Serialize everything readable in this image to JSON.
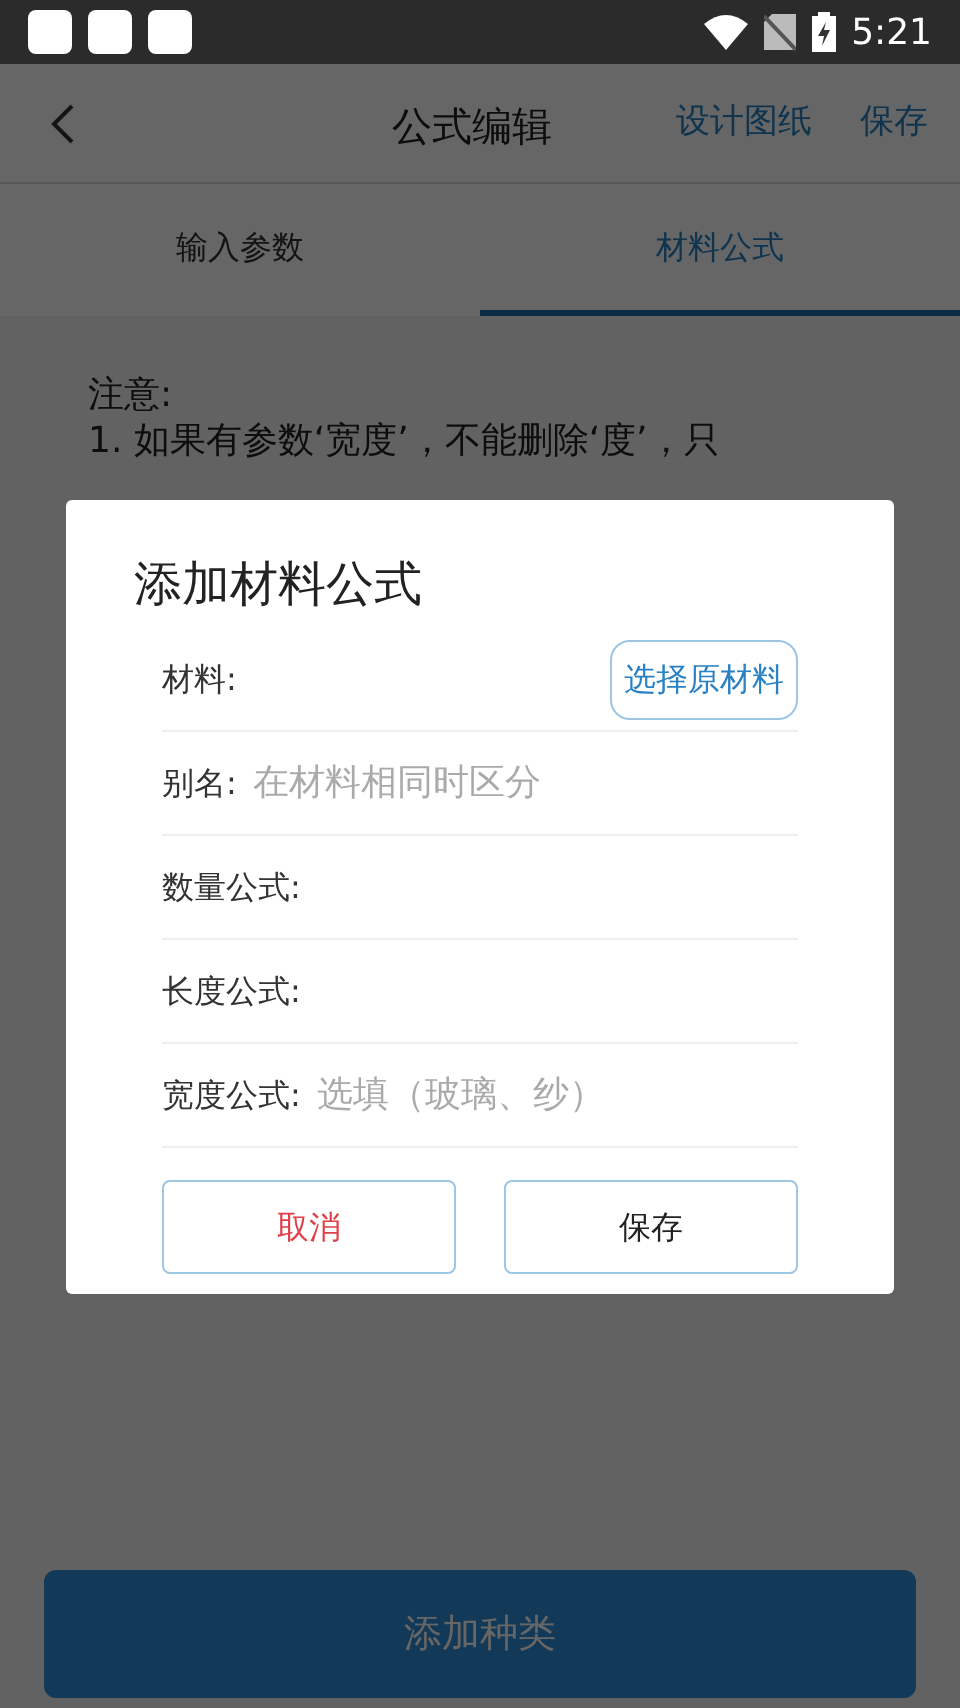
{
  "status_bar": {
    "time": "5:21"
  },
  "app_bar": {
    "title": "公式编辑",
    "actions": [
      "设计图纸",
      "保存"
    ]
  },
  "tabs": [
    {
      "label": "输入参数",
      "selected": false
    },
    {
      "label": "材料公式",
      "selected": true
    }
  ],
  "note": {
    "heading": "注意:",
    "lines": [
      "1. 如果有参数‘宽度’，不能删除‘度’，只"
    ]
  },
  "add_button": "添加种类",
  "dialog": {
    "title": "添加材料公式",
    "fields": [
      {
        "kind": "picker",
        "label": "材料:",
        "button": "选择原材料"
      },
      {
        "kind": "input",
        "label": "别名:",
        "placeholder": "在材料相同时区分"
      },
      {
        "kind": "input",
        "label": "数量公式:"
      },
      {
        "kind": "input",
        "label": "长度公式:"
      },
      {
        "kind": "input",
        "label": "宽度公式:",
        "placeholder": "选填（玻璃、纱）"
      }
    ],
    "buttons": [
      {
        "label": "取消",
        "kind": "cancel"
      },
      {
        "label": "保存",
        "kind": "confirm"
      }
    ]
  }
}
